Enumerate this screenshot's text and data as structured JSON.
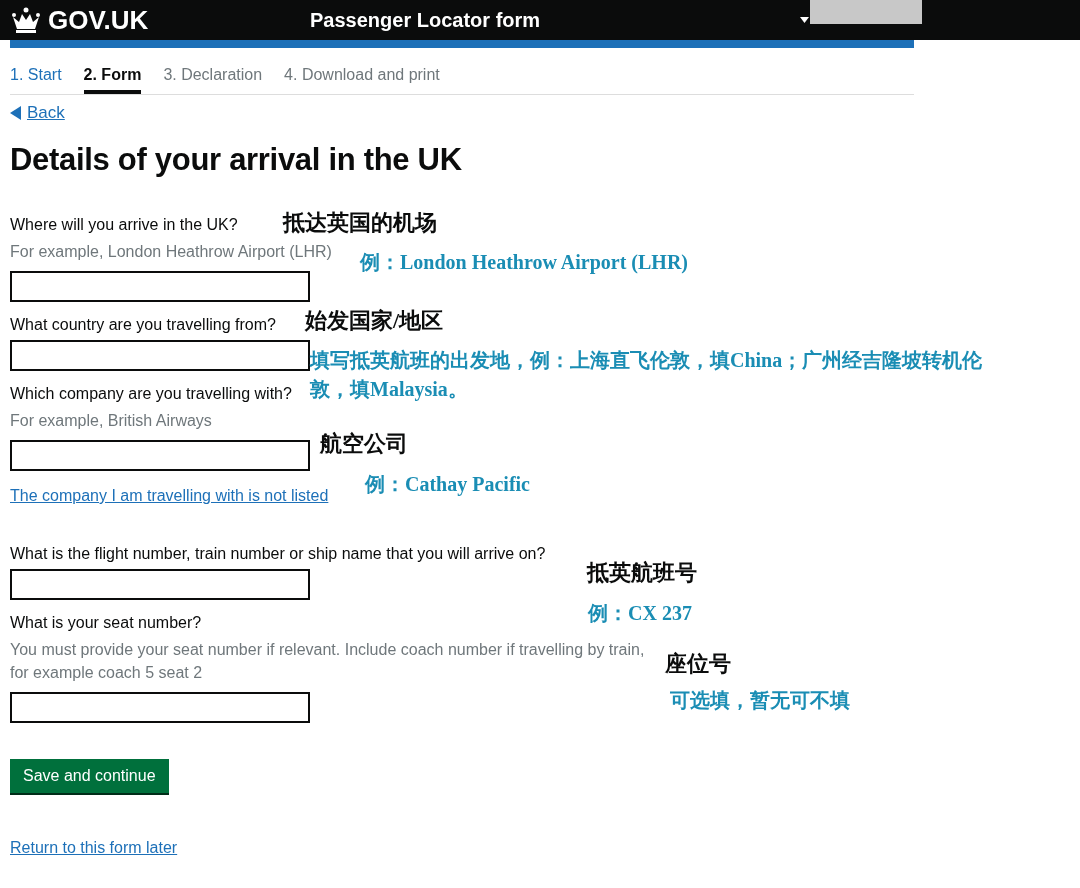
{
  "header": {
    "logo": "GOV.UK",
    "title": "Passenger Locator form"
  },
  "steps": [
    {
      "label": "1. Start",
      "selected": false,
      "done": true
    },
    {
      "label": "2. Form",
      "selected": true,
      "done": false
    },
    {
      "label": "3. Declaration",
      "selected": false,
      "done": false
    },
    {
      "label": "4. Download and print",
      "selected": false,
      "done": false
    }
  ],
  "back_link": "Back",
  "heading": "Details of your arrival in the UK",
  "questions": [
    {
      "label": "Where will you arrive in the UK?",
      "hint": "For example, London Heathrow Airport (LHR)",
      "note": {
        "title": "抵达英国的机场",
        "example": "例：London Heathrow Airport (LHR)"
      }
    },
    {
      "label": "What country are you travelling from?",
      "note": {
        "title": "始发国家/地区",
        "example": "填写抵英航班的出发地，例：上海直飞伦敦，填China；广州经吉隆坡转机伦敦，填Malaysia。"
      }
    },
    {
      "label": "Which company are you travelling with?",
      "hint": "For example, British Airways",
      "link": "The company I am travelling with is not listed",
      "note": {
        "title": "航空公司",
        "example": "例：Cathay Pacific"
      }
    },
    {
      "label": "What is the flight number, train number or ship name that you will arrive on?",
      "note": {
        "title": "抵英航班号",
        "example": "例：CX 237"
      }
    },
    {
      "label": "What is your seat number?",
      "hint": "You must provide your seat number if relevant. Include coach number if travelling by train, for example coach 5 seat 2",
      "note": {
        "title": "座位号",
        "example": "可选填，暂无可不填"
      }
    }
  ],
  "submit_button": "Save and continue",
  "return_link": "Return to this form later"
}
